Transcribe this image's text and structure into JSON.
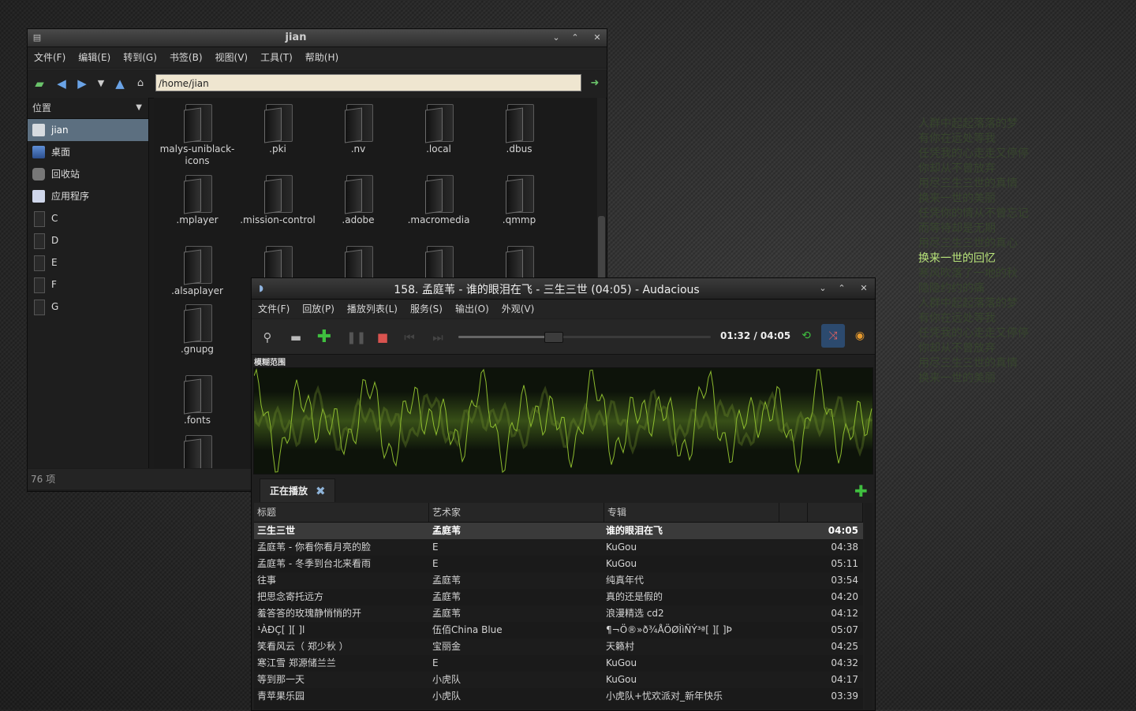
{
  "file_manager": {
    "title": "jian",
    "menu": [
      "文件(F)",
      "编辑(E)",
      "转到(G)",
      "书签(B)",
      "视图(V)",
      "工具(T)",
      "帮助(H)"
    ],
    "address": "/home/jian",
    "side_header": "位置",
    "places": [
      {
        "label": "jian",
        "icon": "home-folder-icon",
        "selected": true
      },
      {
        "label": "桌面",
        "icon": "desktop-icon",
        "selected": false
      },
      {
        "label": "回收站",
        "icon": "trash-icon",
        "selected": false
      },
      {
        "label": "应用程序",
        "icon": "applications-icon",
        "selected": false
      },
      {
        "label": "C",
        "icon": "drive-icon",
        "selected": false
      },
      {
        "label": "D",
        "icon": "drive-icon",
        "selected": false
      },
      {
        "label": "E",
        "icon": "drive-icon",
        "selected": false
      },
      {
        "label": "F",
        "icon": "drive-icon",
        "selected": false
      },
      {
        "label": "G",
        "icon": "drive-icon",
        "selected": false
      }
    ],
    "folders": [
      "malys-uniblack-icons",
      ".pki",
      ".nv",
      ".local",
      ".dbus",
      ".mplayer",
      ".mission-control",
      ".adobe",
      ".macromedia",
      ".qmmp",
      ".alsaplayer",
      ".gnupg",
      ".fonts"
    ],
    "status": "76 项"
  },
  "audacious": {
    "title": "158. 孟庭苇 - 谁的眼泪在飞 - 三生三世 (04:05) - Audacious",
    "menu": [
      "文件(F)",
      "回放(P)",
      "播放列表(L)",
      "服务(S)",
      "输出(O)",
      "外观(V)"
    ],
    "time": "01:32 / 04:05",
    "progress_fraction": 0.375,
    "vis_label": "模糊范围",
    "tab_label": "正在播放",
    "columns": [
      "标题",
      "艺术家",
      "专辑"
    ],
    "playlist": [
      {
        "title": "三生三世",
        "artist": "孟庭苇",
        "album": "谁的眼泪在飞",
        "length": "04:05",
        "current": true
      },
      {
        "title": "孟庭苇 - 你看你看月亮的脸",
        "artist": "E",
        "album": "KuGou",
        "length": "04:38"
      },
      {
        "title": "孟庭苇 - 冬季到台北来看雨",
        "artist": "E",
        "album": "KuGou",
        "length": "05:11"
      },
      {
        "title": "往事",
        "artist": "孟庭苇",
        "album": "纯真年代",
        "length": "03:54"
      },
      {
        "title": "把思念寄托远方",
        "artist": "孟庭苇",
        "album": "真的还是假的",
        "length": "04:20"
      },
      {
        "title": "羞答答的玫瑰静悄悄的开",
        "artist": "孟庭苇",
        "album": "浪漫精选 cd2",
        "length": "04:12"
      },
      {
        "title": "¹ÀÐÇ[ ][ ]l",
        "artist": "伍佰China Blue",
        "album": "¶¬Ö®»ð¾ÅÖØÌìÑÝ³ª[ ][ ]Þ",
        "length": "05:07"
      },
      {
        "title": "笑看风云（ 郑少秋 ）",
        "artist": "宝丽金",
        "album": "天籁村",
        "length": "04:25"
      },
      {
        "title": "寒江雪 郑源储兰兰",
        "artist": "E",
        "album": "KuGou",
        "length": "04:32"
      },
      {
        "title": "等到那一天",
        "artist": "小虎队",
        "album": "KuGou",
        "length": "04:17"
      },
      {
        "title": "青苹果乐园",
        "artist": "小虎队",
        "album": "小虎队+忧欢派对_新年快乐",
        "length": "03:39"
      }
    ]
  },
  "lyrics": {
    "lines": [
      "人群中起起落落的梦",
      "有你在远处等我",
      "任凭我的心走走又停停",
      "你却从不曾放弃",
      "用尽三生三世的真情",
      "换来一世的美丽",
      "任凭你的情从不曾忘记",
      "而等待却是无期",
      "用尽三生三世的真心",
      "换来一世的回忆",
      "寒风吹落了一地的秋",
      "隐隐约约的痛",
      "人群中起起落落的梦",
      "有你在远处等我",
      "任凭我的心走走又停停",
      "你却从不曾放弃",
      "用尽三生三世的真情",
      "换来一世的美丽"
    ],
    "active_index": 9,
    "active_color": "#b8e47a",
    "dim_color": "#36452c"
  },
  "colors": {
    "accent_green": "#3fbf3f",
    "selection_blue": "#5c6f80",
    "stop_red": "#d9534f",
    "waveform_green": "#9acd32"
  }
}
